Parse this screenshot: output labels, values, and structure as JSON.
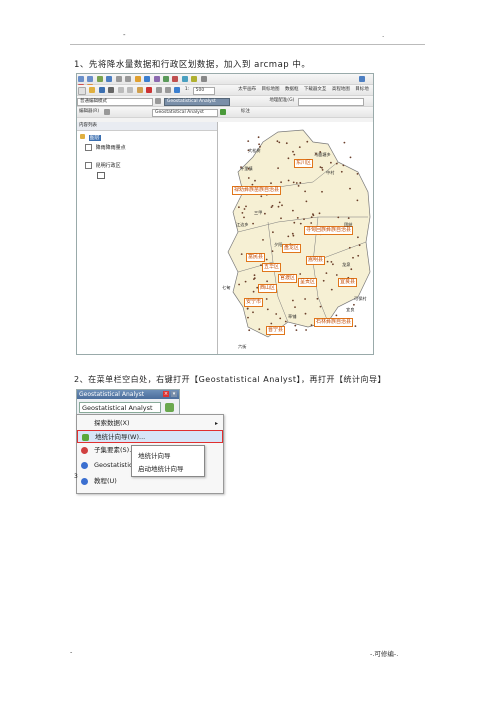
{
  "header": {
    "left_mark": "-",
    "right_mark": "."
  },
  "step1": "1、先将降水量数据和行政区划数据，加入到 arcmap 中。",
  "arcmap": {
    "toolbar1": [
      "1:",
      "500"
    ],
    "toolbar2": [
      "太平画布",
      "目标地图",
      "数据框",
      "下载器文互",
      "高程地图",
      "目标地"
    ],
    "row3_combo": "普通编辑模式",
    "row3_geo": "Geostatistical Analyst",
    "row3_geo_combo": "Geostatistical Analyst",
    "row3_right": "地理配准(G)",
    "row4_left": "编辑器(R)",
    "row5_left": "标注",
    "toc_title": "内容列表",
    "toc_layers": "图层",
    "toc_item1": "降雨降雨量点",
    "toc_item2": "昆明行政区",
    "map_labels": {
      "orange": [
        "禄劝彝族苗族自治县",
        "寻甸回族彝族自治县",
        "富民县",
        "嵩明县",
        "五华区",
        "盘龙区",
        "官渡区",
        "西山区",
        "呈贡区",
        "宜良县",
        "安宁市",
        "晋宁县",
        "石林彝族自治县",
        "东川区"
      ],
      "small": [
        "大松树",
        "马鹿塘乡",
        "中村",
        "十里镇",
        "三甲",
        "江边乡",
        "团结",
        "七甸",
        "龙泉",
        "六街",
        "草铺",
        "夕阳",
        "宜良",
        "可保村"
      ]
    }
  },
  "step2": "2、在菜单栏空白处，右键打开【Geostatistical Analyst】，再打开【统计向导】",
  "geostat": {
    "title": "Geostatistical Analyst",
    "combo": "Geostatistical Analyst",
    "menu": [
      "探索数据(X)",
      "地统计向导(W)...",
      "子集要素(S)...",
      "Geostatistical Analyst 帮助",
      "教程(U)"
    ],
    "submenu": [
      "地统计向导",
      "启动地统计向导"
    ],
    "stray_mark": "3"
  },
  "footer": {
    "left": "-",
    "right": "-.可修编-."
  }
}
